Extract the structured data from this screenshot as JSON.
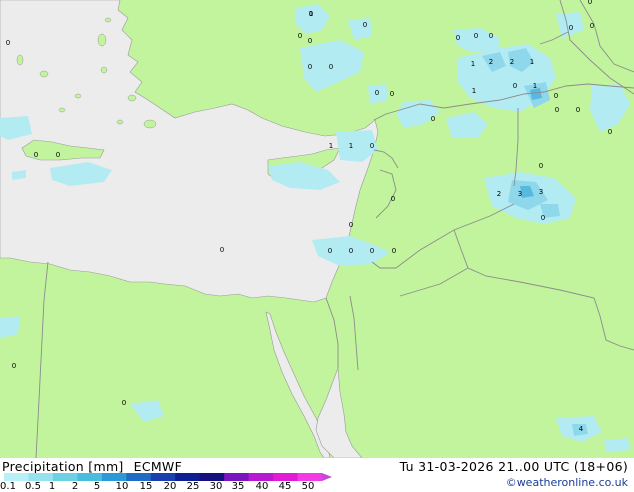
{
  "legend": {
    "title": "Precipitation [mm]",
    "model": "ECMWF",
    "ticks": [
      "0.1",
      "0.5",
      "1",
      "2",
      "5",
      "10",
      "15",
      "20",
      "25",
      "30",
      "35",
      "40",
      "45",
      "50"
    ],
    "colors": [
      "#b7f0f6",
      "#95e2ee",
      "#6ed0e3",
      "#47bde0",
      "#2c9ad6",
      "#1f6cc6",
      "#1b3fb0",
      "#0d1d94",
      "#16107f",
      "#7a16bd",
      "#b81ad1",
      "#e21cd6",
      "#f43ae4",
      "#c44ad6"
    ]
  },
  "valid_time": "Tu 31-03-2026 21..00 UTC (18+06)",
  "credit": "©weatheronline.co.uk",
  "map_colors": {
    "land": "#c1f49c",
    "sea": "#ececec",
    "border": "#8c8c8c",
    "coast": "#999999",
    "precip_light": "#b3ebf2",
    "precip_mid": "#8fd8eb",
    "precip_heavy": "#59b8e0"
  },
  "precip_labels": [
    {
      "text": "1"
    },
    {
      "text": "0"
    },
    {
      "text": "0"
    },
    {
      "text": "0"
    },
    {
      "text": "0"
    },
    {
      "text": "0"
    },
    {
      "text": "0"
    },
    {
      "text": "0"
    },
    {
      "text": "0"
    },
    {
      "text": "2"
    },
    {
      "text": "2"
    },
    {
      "text": "1"
    },
    {
      "text": "1"
    },
    {
      "text": "1"
    },
    {
      "text": "0"
    },
    {
      "text": "0"
    },
    {
      "text": "0"
    },
    {
      "text": "0"
    },
    {
      "text": "0"
    },
    {
      "text": "0"
    },
    {
      "text": "0"
    },
    {
      "text": "1"
    },
    {
      "text": "1"
    },
    {
      "text": "0"
    },
    {
      "text": "0"
    },
    {
      "text": "2"
    },
    {
      "text": "3"
    },
    {
      "text": "3"
    },
    {
      "text": "0"
    },
    {
      "text": "0"
    },
    {
      "text": "0"
    },
    {
      "text": "0"
    },
    {
      "text": "0"
    },
    {
      "text": "0"
    },
    {
      "text": "0"
    },
    {
      "text": "0"
    },
    {
      "text": "0"
    },
    {
      "text": "0"
    },
    {
      "text": "0"
    },
    {
      "text": "0"
    },
    {
      "text": "4"
    },
    {
      "text": "0"
    },
    {
      "text": "0"
    },
    {
      "text": "0"
    },
    {
      "text": "0"
    },
    {
      "text": "0"
    },
    {
      "text": "1"
    },
    {
      "text": "0"
    }
  ]
}
